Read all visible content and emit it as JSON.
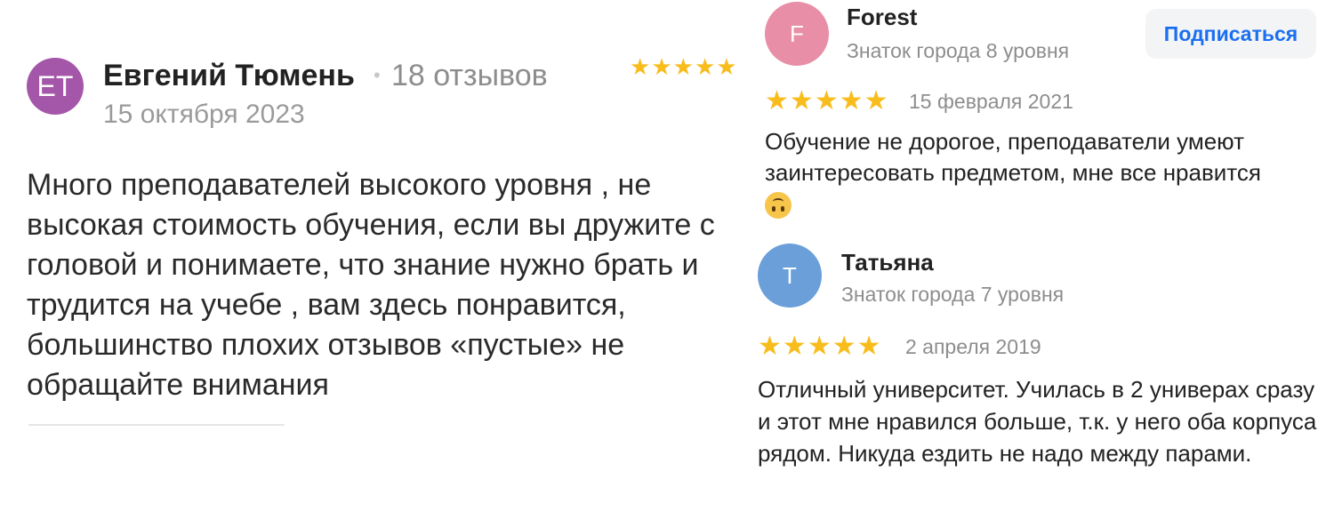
{
  "review_main": {
    "avatar_initials": "ET",
    "author": "Евгений Тюмень",
    "separator": "•",
    "review_count": "18 отзывов",
    "date": "15 октября 2023",
    "rating": 5,
    "text": "Много преподавателей высокого уровня , не высокая стоимость обучения, если вы дружите с головой и понимаете, что знание нужно брать и трудится на учебе , вам здесь понравится, большинство плохих отзывов «пустые» не обращайте внимания"
  },
  "review_forest": {
    "avatar_initials": "F",
    "author": "Forest",
    "level": "Знаток города 8 уровня",
    "subscribe_label": "Подписаться",
    "rating": 5,
    "date": "15 февраля 2021",
    "text": "Обучение не дорогое, преподаватели умеют заинтересовать предметом, мне все нравится",
    "emoji": "upside-down-face-icon"
  },
  "review_tatyana": {
    "avatar_initials": "Т",
    "author": "Татьяна",
    "level": "Знаток города 7 уровня",
    "rating": 5,
    "date": "2 апреля 2019",
    "text": "Отличный университет. Училась в 2 универах сразу и этот мне нравился больше, т.к. у него оба корпуса рядом. Никуда ездить не надо между парами."
  },
  "colors": {
    "star": "#f8bd1c",
    "link": "#1a6ff0",
    "avatar_et": "#a456a9",
    "avatar_f": "#e88ea6",
    "avatar_t": "#6b9fd9"
  }
}
